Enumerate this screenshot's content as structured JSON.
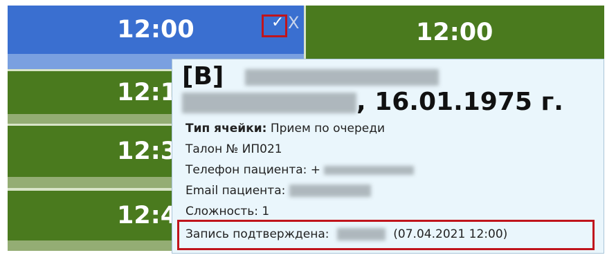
{
  "schedule": {
    "left_column": {
      "slots": [
        {
          "time": "12:00",
          "state": "selected"
        },
        {
          "time": "12:1"
        },
        {
          "time": "12:3"
        },
        {
          "time": "12:4"
        }
      ]
    },
    "right_column": {
      "slots": [
        {
          "time": "12:00"
        }
      ]
    }
  },
  "slot_actions": {
    "confirm_icon": "check-icon",
    "confirm_glyph": "✓",
    "remove_icon": "close-icon",
    "remove_glyph": "X"
  },
  "tooltip": {
    "prefix": "[В]",
    "dob_suffix": ", 16.01.1975 г.",
    "cell_type_label": "Тип ячейки:",
    "cell_type_value": "Прием по очереди",
    "ticket": "Талон № ИП021",
    "phone_label": "Телефон пациента: +",
    "email_label": "Email пациента:",
    "complexity": "Сложность: 1",
    "confirmed_label": "Запись подтверждена:",
    "confirmed_datetime": "(07.04.2021 12:00)"
  },
  "colors": {
    "selected": "#3a6fd0",
    "slot": "#4a7a1e",
    "highlight": "#c0141c",
    "tooltip_bg": "#eaf6fc"
  }
}
